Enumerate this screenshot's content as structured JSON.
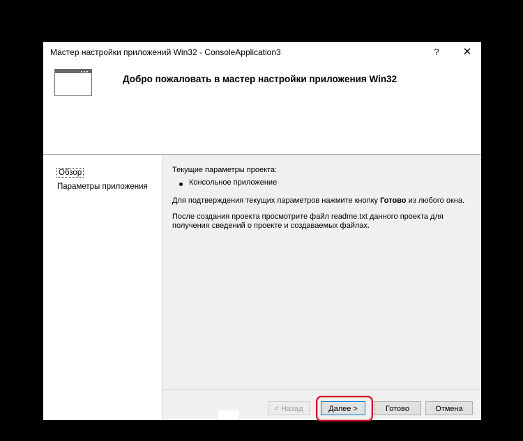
{
  "window": {
    "title": "Мастер настройки приложений Win32 - ConsoleApplication3",
    "help_label": "?",
    "close_label": "✕"
  },
  "header": {
    "title": "Добро пожаловать в мастер настройки приложения Win32"
  },
  "nav": {
    "items": [
      {
        "label": "Обзор"
      },
      {
        "label": "Параметры приложения"
      }
    ]
  },
  "content": {
    "heading": "Текущие параметры проекта:",
    "bullet": "Консольное приложение",
    "confirm_prefix": "Для подтверждения текущих параметров нажмите кнопку ",
    "confirm_bold": "Готово",
    "confirm_suffix": " из любого окна.",
    "note": "После создания проекта просмотрите файл readme.txt данного проекта для получения сведений о проекте и создаваемых файлах."
  },
  "buttons": {
    "back": "< Назад",
    "next": "Далее >",
    "finish": "Готово",
    "cancel": "Отмена"
  },
  "icons": {
    "help": "help-icon",
    "close": "close-icon",
    "wizard": "window-icon"
  },
  "colors": {
    "highlight": "#c8102e",
    "focus": "#0078d7",
    "background": "#000000",
    "dialog": "#f0f0f0"
  }
}
